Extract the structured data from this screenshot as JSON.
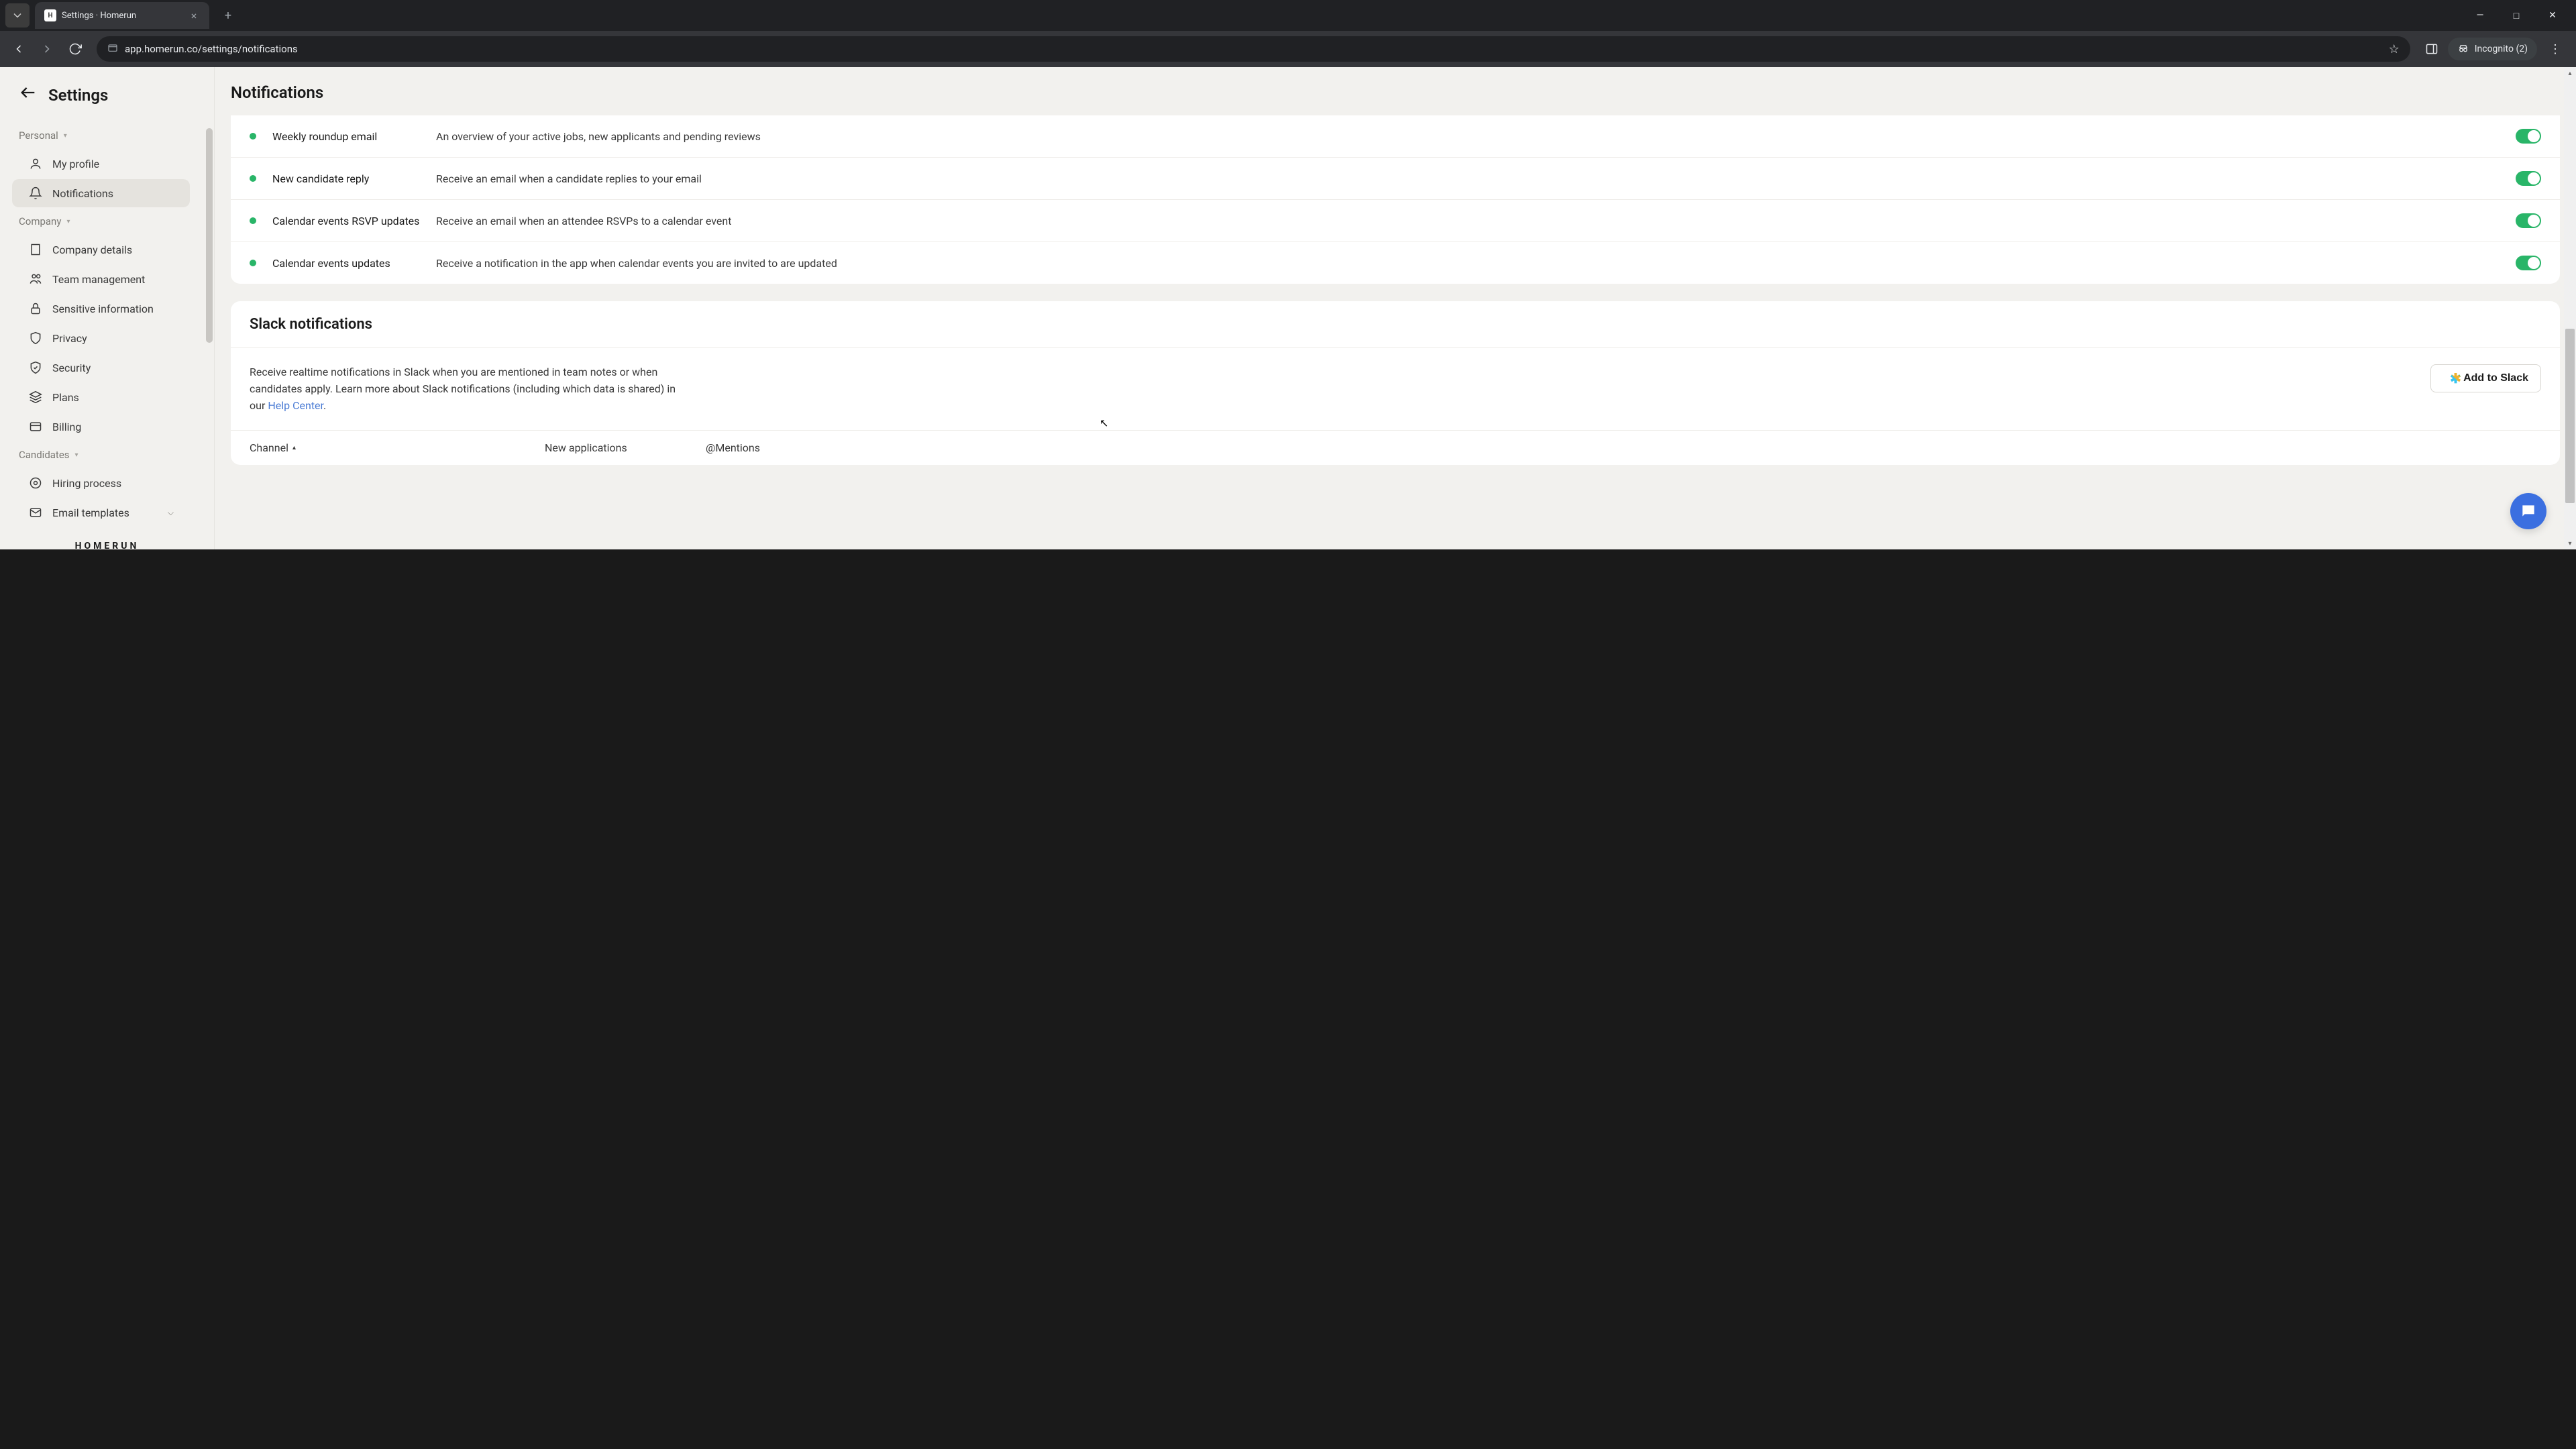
{
  "browser": {
    "tab_title": "Settings · Homerun",
    "url": "app.homerun.co/settings/notifications",
    "incognito_label": "Incognito (2)"
  },
  "sidebar": {
    "title": "Settings",
    "sections": {
      "personal": {
        "label": "Personal",
        "items": [
          {
            "label": "My profile"
          },
          {
            "label": "Notifications"
          }
        ]
      },
      "company": {
        "label": "Company",
        "items": [
          {
            "label": "Company details"
          },
          {
            "label": "Team management"
          },
          {
            "label": "Sensitive information"
          },
          {
            "label": "Privacy"
          },
          {
            "label": "Security"
          },
          {
            "label": "Plans"
          },
          {
            "label": "Billing"
          }
        ]
      },
      "candidates": {
        "label": "Candidates",
        "items": [
          {
            "label": "Hiring process"
          },
          {
            "label": "Email templates"
          }
        ]
      }
    },
    "brand": "HOMERUN"
  },
  "main": {
    "title": "Notifications",
    "email_notifs": [
      {
        "name": "Weekly roundup email",
        "desc": "An overview of your active jobs, new applicants and pending reviews",
        "on": true
      },
      {
        "name": "New candidate reply",
        "desc": "Receive an email when a candidate replies to your email",
        "on": true
      },
      {
        "name": "Calendar events RSVP updates",
        "desc": "Receive an email when an attendee RSVPs to a calendar event",
        "on": true
      },
      {
        "name": "Calendar events updates",
        "desc": "Receive a notification in the app when calendar events you are invited to are updated",
        "on": true
      }
    ],
    "slack": {
      "heading": "Slack notifications",
      "desc_1": "Receive realtime notifications in Slack when you are mentioned in team notes or when candidates apply. Learn more about Slack notifications (including which data is shared) in our ",
      "help_link": "Help Center",
      "desc_2": ".",
      "button": "Add to Slack",
      "table": {
        "col_channel": "Channel",
        "col_new_apps": "New applications",
        "col_mentions": "@Mentions"
      }
    }
  },
  "colors": {
    "accent_toggle": "#29b568",
    "link": "#4a7bd4",
    "fab": "#3b6fe0"
  }
}
